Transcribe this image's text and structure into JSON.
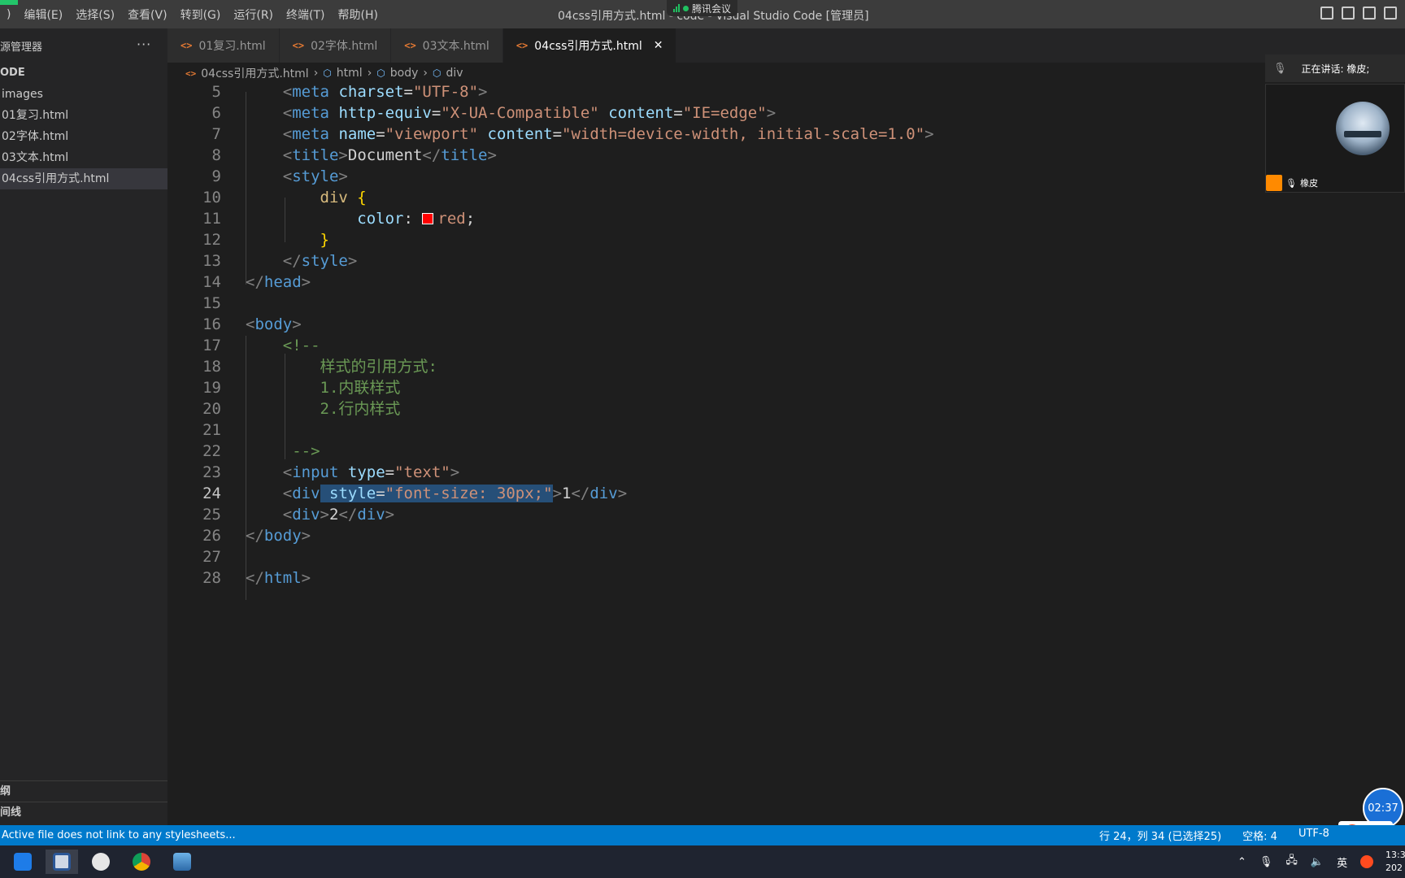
{
  "titlebar": {
    "menu": [
      ")",
      "编辑(E)",
      "选择(S)",
      "查看(V)",
      "转到(G)",
      "运行(R)",
      "终端(T)",
      "帮助(H)"
    ],
    "title": "04css引用方式.html - code - Visual Studio Code [管理员]",
    "meeting_app": "腾讯会议"
  },
  "sidebar": {
    "header": "源管理器",
    "more": "···",
    "root": "ODE",
    "items": [
      {
        "label": "images"
      },
      {
        "label": "01复习.html"
      },
      {
        "label": "02字体.html"
      },
      {
        "label": "03文本.html"
      },
      {
        "label": "04css引用方式.html"
      }
    ],
    "bottom": [
      "纲",
      "间线"
    ]
  },
  "tabs": [
    {
      "label": "01复习.html",
      "icon": "<>"
    },
    {
      "label": "02字体.html",
      "icon": "<>"
    },
    {
      "label": "03文本.html",
      "icon": "<>"
    },
    {
      "label": "04css引用方式.html",
      "icon": "<>",
      "close": "✕"
    }
  ],
  "breadcrumb": {
    "file": "04css引用方式.html",
    "parts": [
      "html",
      "body",
      "div"
    ],
    "sep": "›"
  },
  "editor": {
    "line_numbers": [
      "5",
      "6",
      "7",
      "8",
      "9",
      "10",
      "11",
      "12",
      "13",
      "14",
      "15",
      "16",
      "17",
      "18",
      "19",
      "20",
      "21",
      "22",
      "23",
      "24",
      "25",
      "26",
      "27",
      "28"
    ],
    "current_line": "24",
    "tokens": {
      "l5": [
        "<",
        "meta",
        "charset",
        "=",
        "\"UTF-8\"",
        ">"
      ],
      "l6": [
        "<",
        "meta",
        "http-equiv",
        "=",
        "\"X-UA-Compatible\"",
        "content",
        "=",
        "\"IE=edge\"",
        ">"
      ],
      "l7": [
        "<",
        "meta",
        "name",
        "=",
        "\"viewport\"",
        "content",
        "=",
        "\"width=device-width, initial-scale=1.0\"",
        ">"
      ],
      "l8": [
        "<",
        "title",
        ">",
        "Document",
        "</",
        "title",
        ">"
      ],
      "l9": [
        "<",
        "style",
        ">"
      ],
      "l10": [
        "div",
        "{"
      ],
      "l11": [
        "color",
        ":",
        "red",
        ";"
      ],
      "l12": [
        "}"
      ],
      "l13": [
        "</",
        "style",
        ">"
      ],
      "l14": [
        "</",
        "head",
        ">"
      ],
      "l16": [
        "<",
        "body",
        ">"
      ],
      "l17": [
        "<!--"
      ],
      "l18": [
        "样式的引用方式:"
      ],
      "l19": [
        "1.内联样式"
      ],
      "l20": [
        "2.行内样式"
      ],
      "l22": [
        "-->"
      ],
      "l23": [
        "<",
        "input",
        "type",
        "=",
        "\"text\"",
        ">"
      ],
      "l24": [
        "<",
        "div",
        " ",
        "style",
        "=",
        "\"font-size: 30px;\"",
        ">",
        "1",
        "</",
        "div",
        ">"
      ],
      "l25": [
        "<",
        "div",
        ">",
        "2",
        "</",
        "div",
        ">"
      ],
      "l26": [
        "</",
        "body",
        ">"
      ],
      "l28": [
        "</",
        "html",
        ">"
      ]
    }
  },
  "meeting": {
    "speaking": "正在讲话: 橡皮;",
    "participant": "橡皮",
    "timer": "02:37"
  },
  "ime": {
    "logo": "S",
    "lang": "英",
    "punct": "’,"
  },
  "statusbar": {
    "message": "Active file does not link to any stylesheets...",
    "position": "行 24，列 34 (已选择25)",
    "spaces": "空格: 4",
    "encoding": "UTF-8"
  },
  "tray": {
    "ime": "英",
    "clock_time": "13:3",
    "clock_date": "202"
  },
  "colors": {
    "accent": "#007acc",
    "swatch_red": "#ff0000",
    "selection": "#264f78"
  }
}
